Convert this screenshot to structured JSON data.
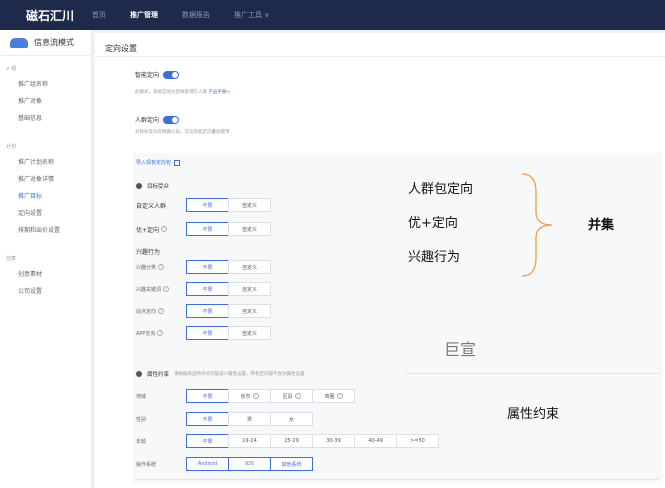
{
  "app": {
    "logo": "磁石汇川"
  },
  "nav": {
    "items": [
      "首页",
      "推广管理",
      "数据报告",
      "推广工具 ∨"
    ],
    "active": 1
  },
  "sidebar": {
    "mode_label": "信息流模式",
    "groups": [
      {
        "header": "∨ 组",
        "items": [
          "推广组名称",
          "推广对象",
          "基础信息"
        ]
      },
      {
        "header": "计划",
        "items": [
          "推广计划名称",
          "推广对象详情",
          "推广目标",
          "定向设置",
          "排期和出价设置"
        ]
      },
      {
        "header": "创意",
        "items": [
          "创意素材",
          "公司设置"
        ]
      }
    ],
    "active_item": "推广目标"
  },
  "page": {
    "title": "定向设置"
  },
  "smart": {
    "label": "智能定向",
    "desc": "此模式，系统自动为您探索潜在人群",
    "link": "产品手册>"
  },
  "crowd": {
    "label": "人群定向",
    "desc": "对目标受众有精确认知，可与智能定向叠加使用"
  },
  "panel": {
    "import_link": "导入现有定向包",
    "audience_section": "目标受众",
    "custom_crowd": {
      "label": "自定义人群",
      "opts": [
        "不限",
        "自定义"
      ]
    },
    "youplus": {
      "label": "优+定向",
      "opts": [
        "不限",
        "自定义"
      ]
    },
    "interest_title": "兴趣行为",
    "interest_rows": [
      {
        "label": "兴趣分类",
        "opts": [
          "不限",
          "自定义"
        ]
      },
      {
        "label": "兴趣关键词",
        "opts": [
          "不限",
          "自定义"
        ]
      },
      {
        "label": "站点定向",
        "opts": [
          "不限",
          "自定义"
        ]
      },
      {
        "label": "APP定向",
        "opts": [
          "不限",
          "自定义"
        ]
      }
    ],
    "attr_section": "属性约束",
    "attr_desc": "请根据商品特点尽可能减少属性设置，所有定向都不会对属性设置",
    "region": {
      "label": "地域",
      "opts": [
        "不限",
        "省市",
        "区县",
        "商圈"
      ]
    },
    "gender": {
      "label": "性别",
      "opts": [
        "不限",
        "男",
        "女"
      ]
    },
    "age": {
      "label": "年龄",
      "opts": [
        "不限",
        "19-24",
        "25-29",
        "30-39",
        "40-49",
        ">=50"
      ]
    },
    "os": {
      "label": "操作系统",
      "opts": [
        "Android",
        "IOS",
        "其他系统"
      ]
    }
  },
  "annotations": {
    "crowd": "人群包定向",
    "youplus": "优+定向",
    "interest": "兴趣行为",
    "union": "并集",
    "watermark": "巨宣",
    "attr": "属性约束"
  },
  "colors": {
    "accent": "#3b6fe0",
    "topbar": "#1e2a4a",
    "brace": "#f0a040"
  }
}
